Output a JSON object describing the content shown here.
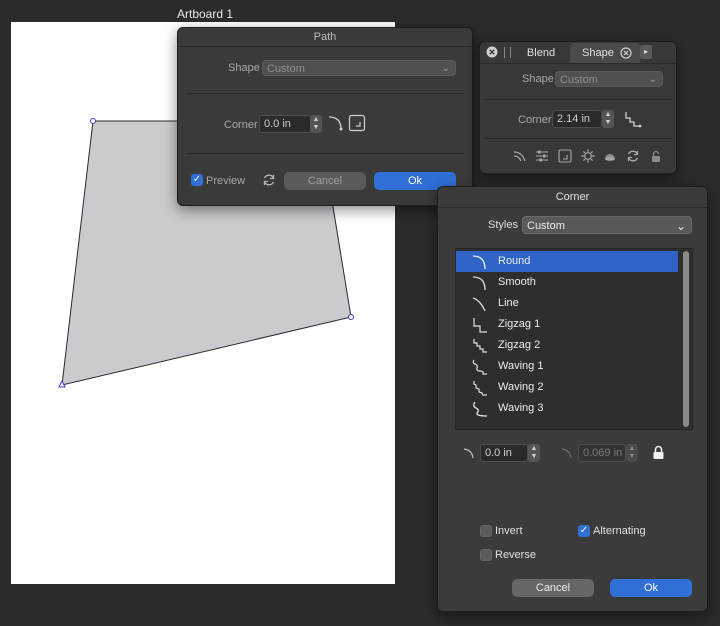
{
  "artboard": {
    "label": "Artboard 1"
  },
  "path_panel": {
    "title": "Path",
    "shape_label": "Shape",
    "shape_value": "Custom",
    "corner_label": "Corner",
    "corner_value": "0.0 in",
    "preview_label": "Preview",
    "preview_checked": true,
    "cancel_label": "Cancel",
    "ok_label": "Ok"
  },
  "blend_panel": {
    "tabs": [
      {
        "label": "Blend"
      },
      {
        "label": "Shape"
      }
    ],
    "shape_label": "Shape",
    "shape_value": "Custom",
    "corner_label": "Corner",
    "corner_value": "2.14 in",
    "tool_icons": [
      "curve-icon",
      "sliders-icon",
      "corner-box-icon",
      "gear-cog-icon",
      "sphere-icon",
      "refresh-icon",
      "lock-icon"
    ]
  },
  "corner_dialog": {
    "title": "Corner",
    "styles_label": "Styles",
    "styles_value": "Custom",
    "items": [
      {
        "label": "Round",
        "selected": true
      },
      {
        "label": "Smooth",
        "selected": false
      },
      {
        "label": "Line",
        "selected": false
      },
      {
        "label": "Zigzag 1",
        "selected": false
      },
      {
        "label": "Zigzag 2",
        "selected": false
      },
      {
        "label": "Waving 1",
        "selected": false
      },
      {
        "label": "Waving 2",
        "selected": false
      },
      {
        "label": "Waving 3",
        "selected": false
      }
    ],
    "radius_value": "0.0 in",
    "secondary_value": "0.069 in",
    "invert_label": "Invert",
    "invert_checked": false,
    "alternating_label": "Alternating",
    "alternating_checked": true,
    "reverse_label": "Reverse",
    "reverse_checked": false,
    "cancel_label": "Cancel",
    "ok_label": "Ok"
  },
  "colors": {
    "accent": "#2f6fd6",
    "panel": "#3a3a3a",
    "background": "#2b2b2b",
    "shape_fill": "#cacbcf"
  }
}
